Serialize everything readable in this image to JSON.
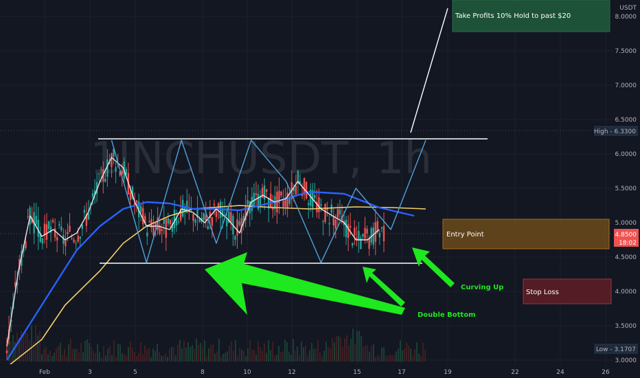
{
  "chart_data": {
    "type": "candlestick",
    "watermark": "1INCHUSDT, 1h",
    "currency": "USDT",
    "ylim": [
      3.0,
      8.3
    ],
    "y_ticks": [
      "8.0000",
      "7.5000",
      "7.0000",
      "6.5000",
      "6.0000",
      "5.5000",
      "5.0000",
      "4.5000",
      "4.0000",
      "3.5000",
      "3.0000"
    ],
    "x_ticks": [
      "Feb",
      "3",
      "5",
      "8",
      "10",
      "12",
      "15",
      "17",
      "19",
      "22",
      "24",
      "26"
    ],
    "high_label": "High - 6.3300",
    "low_label": "Low - 3.1707",
    "price_label": "4.8500",
    "countdown": "18:02",
    "resistance": 6.22,
    "support": 4.41,
    "ma_yellow": [
      [
        0,
        2.9
      ],
      [
        3,
        3.3
      ],
      [
        5,
        3.8
      ],
      [
        8,
        4.3
      ],
      [
        10,
        4.7
      ],
      [
        12,
        4.95
      ],
      [
        14,
        5.1
      ],
      [
        16,
        5.2
      ],
      [
        20,
        5.25
      ],
      [
        23,
        5.22
      ],
      [
        26,
        5.2
      ],
      [
        30,
        5.23
      ],
      [
        33,
        5.22
      ],
      [
        36,
        5.2
      ]
    ],
    "ma_blue": [
      [
        0,
        3.0
      ],
      [
        3,
        3.8
      ],
      [
        6,
        4.6
      ],
      [
        8,
        4.95
      ],
      [
        10,
        5.2
      ],
      [
        12,
        5.3
      ],
      [
        14,
        5.28
      ],
      [
        16,
        5.2
      ],
      [
        18,
        5.2
      ],
      [
        20,
        5.18
      ],
      [
        23,
        5.3
      ],
      [
        26,
        5.45
      ],
      [
        29,
        5.42
      ],
      [
        32,
        5.22
      ],
      [
        35,
        5.1
      ]
    ],
    "ma_white": [
      [
        0,
        3.2
      ],
      [
        1,
        4.3
      ],
      [
        2,
        5.1
      ],
      [
        3,
        4.8
      ],
      [
        4,
        4.9
      ],
      [
        5,
        4.75
      ],
      [
        6,
        4.85
      ],
      [
        7,
        5.15
      ],
      [
        8,
        5.6
      ],
      [
        9,
        5.95
      ],
      [
        10,
        5.8
      ],
      [
        11,
        5.3
      ],
      [
        12,
        4.95
      ],
      [
        13,
        4.95
      ],
      [
        14,
        4.9
      ],
      [
        15,
        5.2
      ],
      [
        16,
        5.15
      ],
      [
        17,
        5.0
      ],
      [
        18,
        5.2
      ],
      [
        19,
        5.05
      ],
      [
        20,
        4.85
      ],
      [
        21,
        5.3
      ],
      [
        22,
        5.4
      ],
      [
        23,
        5.3
      ],
      [
        24,
        5.35
      ],
      [
        25,
        5.6
      ],
      [
        26,
        5.4
      ],
      [
        27,
        5.2
      ],
      [
        28,
        5.1
      ],
      [
        29,
        5.0
      ],
      [
        30,
        4.75
      ],
      [
        31,
        4.75
      ],
      [
        32,
        4.9
      ]
    ],
    "zigzag_blue": [
      [
        9,
        6.2
      ],
      [
        12,
        4.42
      ],
      [
        15,
        6.2
      ],
      [
        18,
        4.7
      ],
      [
        21,
        6.2
      ],
      [
        24,
        5.6
      ],
      [
        27,
        4.42
      ],
      [
        30,
        5.5
      ],
      [
        33,
        4.9
      ],
      [
        36,
        6.2
      ]
    ],
    "projection_line": [
      [
        36,
        6.32
      ],
      [
        37,
        8.2
      ]
    ],
    "boxes": {
      "take_profit": {
        "label": "Take Profits 10% Hold to past $20",
        "color": "#1f5c3c"
      },
      "entry": {
        "label": "Entry Point",
        "color": "#6b4a1a"
      },
      "stop_loss": {
        "label": "Stop Loss",
        "color": "#5c1d26"
      }
    },
    "annotations": {
      "double_bottom": "Double Bottom",
      "curving_up": "Curving Up"
    }
  }
}
